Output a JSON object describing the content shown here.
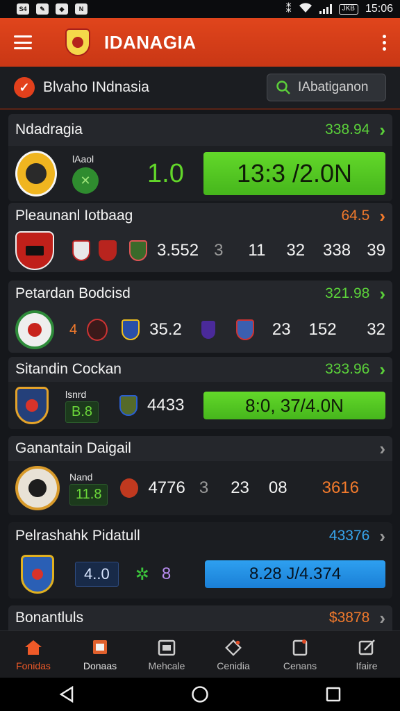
{
  "status_bar": {
    "time": "15:06",
    "battery": "JKB",
    "left_icons": [
      "S4",
      "✎",
      "◆",
      "N"
    ]
  },
  "app": {
    "title": "IDANAGIA"
  },
  "filter": {
    "label": "Blvaho INdnasia",
    "search_placeholder": "IAbatiganon"
  },
  "matches": [
    {
      "name": "Ndadragia",
      "odds": "338.94",
      "odds_color": "#5bd13a",
      "team_tag": "lAaol",
      "score": "1.0",
      "bar": "13:3 /2.0N"
    },
    {
      "name": "Pleaunanl Iotbaag",
      "odds": "64.5",
      "odds_color": "#f27a2c",
      "cells": [
        "3.552",
        "3",
        "11",
        "32",
        "338",
        "39"
      ]
    },
    {
      "name": "Petardan Bodcisd",
      "odds": "321.98",
      "odds_color": "#5bd13a",
      "cells": [
        "4",
        "35.2",
        "23",
        "152",
        "32"
      ]
    },
    {
      "name": "Sitandin Cockan",
      "odds": "333.96",
      "odds_color": "#5bd13a",
      "team_tag": "lsnrd",
      "box": "B.8",
      "num": "4433",
      "bar": "8:0,  37/4.0N"
    },
    {
      "name": "Ganantain Daigail",
      "odds": "",
      "odds_color": "#5bd13a",
      "team_tag": "Nand",
      "box": "11.8",
      "cells": [
        "4776",
        "3",
        "23",
        "08",
        "3616"
      ]
    },
    {
      "name": "Pelrashahk Pidatull",
      "odds": "43376",
      "odds_color": "#38a6ee",
      "box": "4..0",
      "glyph": "8",
      "bar": "8.28  J/4.374"
    },
    {
      "name": "Bonantluls",
      "odds": "$3878",
      "odds_color": "#f27a2c"
    }
  ],
  "nav": [
    {
      "label": "Fonidas",
      "icon": "home-icon"
    },
    {
      "label": "Donaas",
      "icon": "box-icon"
    },
    {
      "label": "Mehcale",
      "icon": "calendar-icon"
    },
    {
      "label": "Cenidia",
      "icon": "tag-icon"
    },
    {
      "label": "Cenans",
      "icon": "clipboard-icon"
    },
    {
      "label": "Ifaire",
      "icon": "edit-icon"
    }
  ],
  "colors": {
    "accent": "#e2401c",
    "green": "#5bd13a",
    "blue": "#2a98ea",
    "orange": "#f27a2c"
  }
}
